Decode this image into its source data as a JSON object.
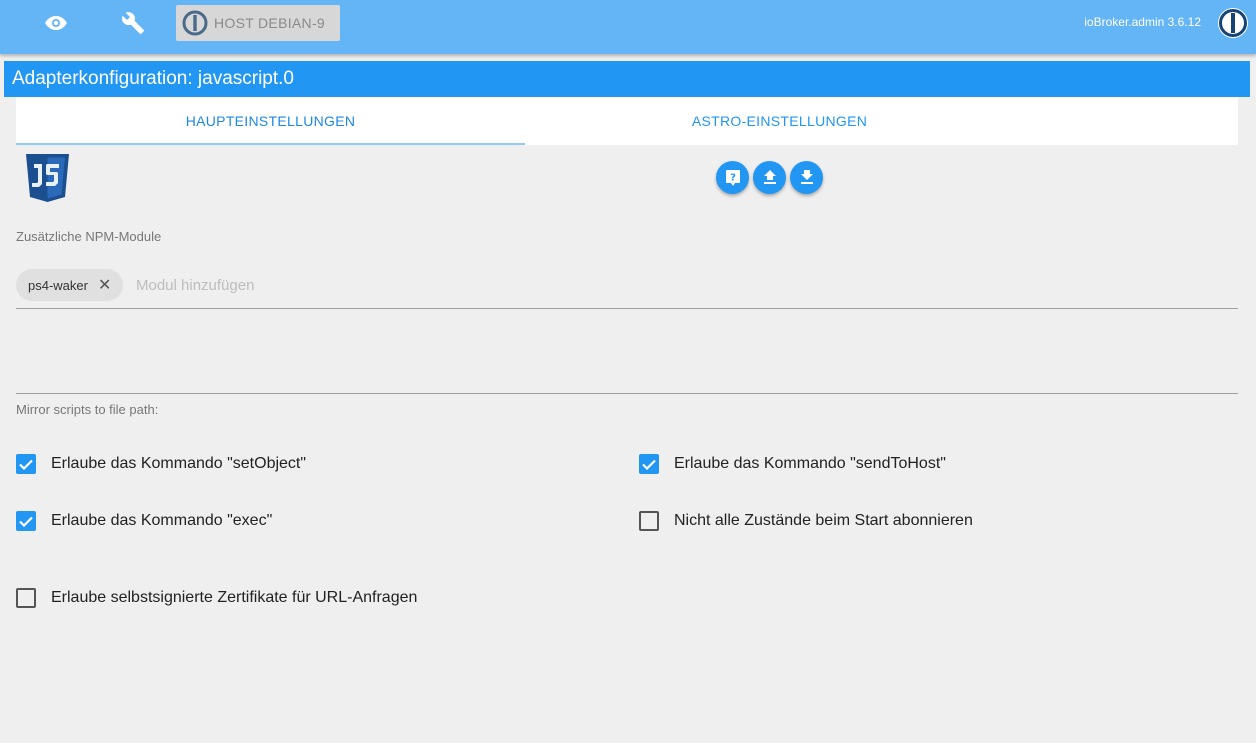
{
  "topbar": {
    "host_label": "HOST DEBIAN-9",
    "version": "ioBroker.admin 3.6.12",
    "icons": [
      "eye-icon",
      "wrench-icon",
      "iobroker-logo-icon"
    ]
  },
  "title": "Adapterkonfiguration: javascript.0",
  "tabs": [
    {
      "label": "HAUPTEINSTELLUNGEN",
      "active": true
    },
    {
      "label": "ASTRO-EINSTELLUNGEN",
      "active": false
    }
  ],
  "action_buttons": [
    "help-icon",
    "upload-icon",
    "download-icon"
  ],
  "npm": {
    "label": "Zusätzliche NPM-Module",
    "chips": [
      "ps4-waker"
    ],
    "placeholder": "Modul hinzufügen"
  },
  "mirror": {
    "label": "Mirror scripts to file path:",
    "value": ""
  },
  "options": {
    "setObject": {
      "label": "Erlaube das Kommando \"setObject\"",
      "checked": true
    },
    "sendToHost": {
      "label": "Erlaube das Kommando \"sendToHost\"",
      "checked": true
    },
    "exec": {
      "label": "Erlaube das Kommando \"exec\"",
      "checked": true
    },
    "subscribe": {
      "label": "Nicht alle Zustände beim Start abonnieren",
      "checked": false
    },
    "selfsigned": {
      "label": "Erlaube selbstsignierte Zertifikate für URL-Anfragen",
      "checked": false
    }
  },
  "colors": {
    "topbar": "#64b5f6",
    "primary": "#2196f3"
  }
}
